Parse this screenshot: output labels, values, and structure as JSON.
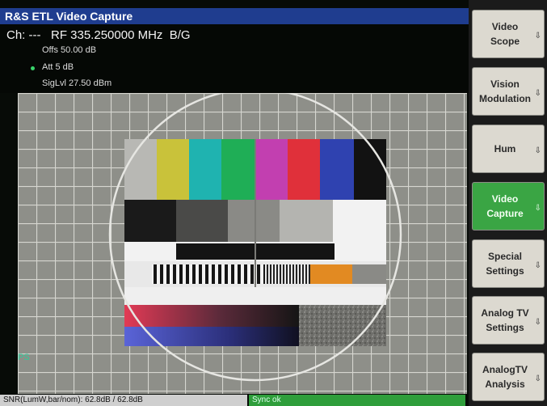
{
  "window": {
    "title": "R&S ETL Video Capture"
  },
  "header": {
    "channel_line": "Ch: ---   RF 335.250000 MHz  B/G",
    "offset": "Offs 50.00 dB",
    "attenuation": "Att   5 dB",
    "signal_level": "SigLvl 27.50 dBm"
  },
  "display": {
    "corner_label": "PS"
  },
  "status": {
    "snr": "SNR(LumW,bar/nom): 62.8dB / 62.8dB",
    "sync": "Sync ok"
  },
  "softkeys": [
    {
      "label": "Video\nScope",
      "active": false
    },
    {
      "label": "Vision\nModulation",
      "active": false
    },
    {
      "label": "Hum",
      "active": false
    },
    {
      "label": "Video\nCapture",
      "active": true
    },
    {
      "label": "Special\nSettings",
      "active": false
    },
    {
      "label": "Analog TV\nSettings",
      "active": false
    },
    {
      "label": "AnalogTV\nAnalysis",
      "active": false
    }
  ],
  "colors": {
    "title_bar": "#1f3d8f",
    "active_softkey": "#3aa544",
    "sync_ok": "#2f9e3b",
    "color_bars": [
      "#b8b8b4",
      "#c9c23a",
      "#1fb3b0",
      "#1fae56",
      "#c23fb0",
      "#e0303a",
      "#2f42b0",
      "#121212"
    ]
  }
}
